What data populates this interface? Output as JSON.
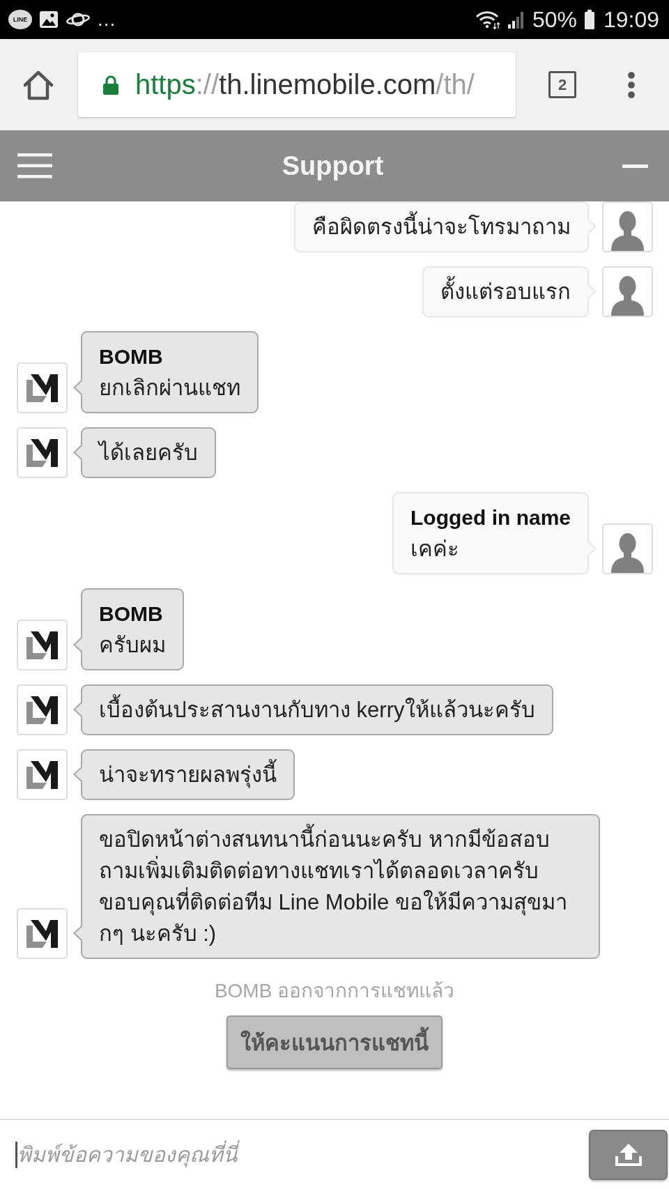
{
  "status_bar": {
    "notifications": [
      {
        "kind": "app_logo",
        "label": "LINE"
      },
      {
        "kind": "image"
      },
      {
        "kind": "planet"
      }
    ],
    "overflow": "...",
    "battery": "50%",
    "time": "19:09"
  },
  "browser": {
    "url": [
      {
        "kind": "scheme",
        "text": "https"
      },
      {
        "kind": "separator",
        "text": "://"
      },
      {
        "kind": "host",
        "text": "th.linemobile.com"
      },
      {
        "kind": "path",
        "text": "/th/"
      }
    ],
    "tab_count": "2"
  },
  "header": {
    "title": "Support"
  },
  "messages": [
    {
      "kind": "user",
      "text": "คือผิดตรงนี้น่าจะโทรมาถาม"
    },
    {
      "kind": "user",
      "text": "ตั้งแต่รอบแรก"
    },
    {
      "kind": "agent",
      "name": "BOMB",
      "text": "ยกเลิกผ่านแชท"
    },
    {
      "kind": "agent",
      "text": "ได้เลยครับ"
    },
    {
      "kind": "user",
      "name": "Logged in name",
      "text": "เคค่ะ"
    },
    {
      "kind": "agent",
      "name": "BOMB",
      "text": "ครับผม"
    },
    {
      "kind": "agent",
      "text": "เบื้องต้นประสานงานกับทาง kerryให้แล้วนะครับ"
    },
    {
      "kind": "agent",
      "text": "น่าจะทรายผลพรุ่งนี้"
    },
    {
      "kind": "agent",
      "text": "ขอปิดหน้าต่างสนทนานี้ก่อนนะครับ หากมีข้อสอบถามเพิ่มเติมติดต่อทางแชทเราได้ตลอดเวลาครับ ขอบคุณที่ติดต่อทีม Line Mobile ขอให้มีความสุขมากๆ นะครับ :)"
    }
  ],
  "system_note": "BOMB ออกจากการแชทแล้ว",
  "rate_button": "ให้คะแนนการแชทนี้",
  "composer": {
    "placeholder": "พิมพ์ข้อความของคุณที่นี่"
  }
}
